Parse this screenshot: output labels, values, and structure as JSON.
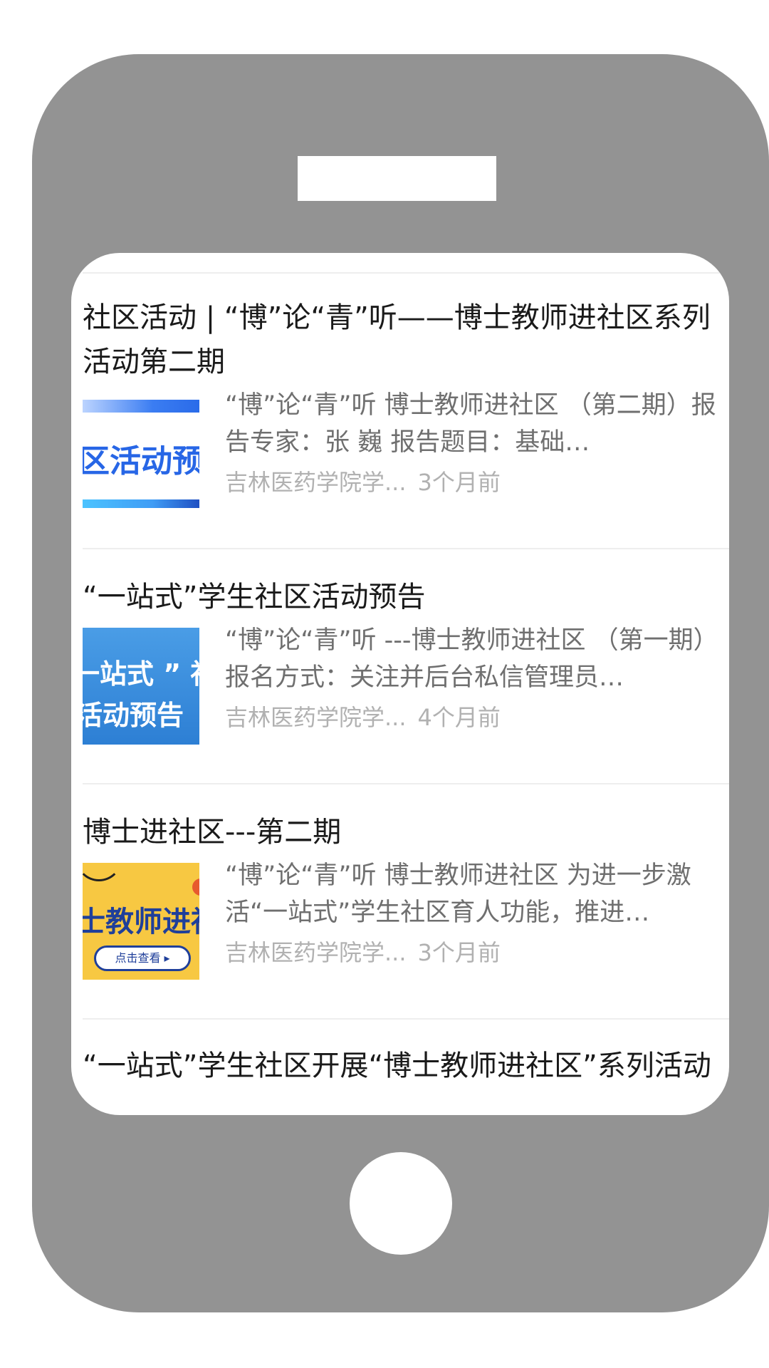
{
  "articles": [
    {
      "title": "社区活动 | “博”论“青”听——博士教师进社区系列活动第二期",
      "thumb_text": "区活动预",
      "summary": "“博”论“青”听 博士教师进社区 （第二期）报告专家：张 巍 报告题目：基础…",
      "source": "吉林医药学院学...",
      "time": "3个月前"
    },
    {
      "title": "“一站式”学生社区活动预告",
      "thumb_text_line1": "一站式 ” 社",
      "thumb_text_line2": "活动预告",
      "summary": "“博”论“青”听 ---博士教师进社区 （第一期）报名方式：关注并后台私信管理员…",
      "source": "吉林医药学院学...",
      "time": "4个月前"
    },
    {
      "title": "博士进社区---第二期",
      "thumb_text": "士教师进社",
      "thumb_button": "点击查看 ▸",
      "summary": "“博”论“青”听 博士教师进社区 为进一步激活“一站式”学生社区育人功能，推进…",
      "source": "吉林医药学院学...",
      "time": "3个月前"
    },
    {
      "title": "“一站式”学生社区开展“博士教师进社区”系列活动"
    }
  ],
  "colors": {
    "frame": "#939393",
    "title_text": "#1a1a1a",
    "summary_text": "#6f6f6f",
    "meta_text": "#b1b1b1"
  }
}
